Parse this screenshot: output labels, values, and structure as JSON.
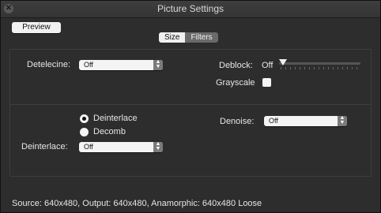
{
  "window": {
    "title": "Picture Settings"
  },
  "toolbar": {
    "preview_label": "Preview"
  },
  "tabs": [
    {
      "label": "Size",
      "selected": false
    },
    {
      "label": "Filters",
      "selected": true
    }
  ],
  "filters": {
    "detelecine": {
      "label": "Detelecine:",
      "value": "Off"
    },
    "deblock": {
      "label": "Deblock:",
      "value": "Off",
      "level": 0
    },
    "grayscale": {
      "label": "Grayscale",
      "checked": false
    },
    "deinterlace_mode": {
      "options": [
        {
          "label": "Deinterlace",
          "selected": true
        },
        {
          "label": "Decomb",
          "selected": false
        }
      ]
    },
    "deinterlace": {
      "label": "Deinterlace:",
      "value": "Off"
    },
    "denoise": {
      "label": "Denoise:",
      "value": "Off"
    }
  },
  "status": {
    "text": "Source: 640x480, Output: 640x480, Anamorphic: 640x480 Loose"
  }
}
